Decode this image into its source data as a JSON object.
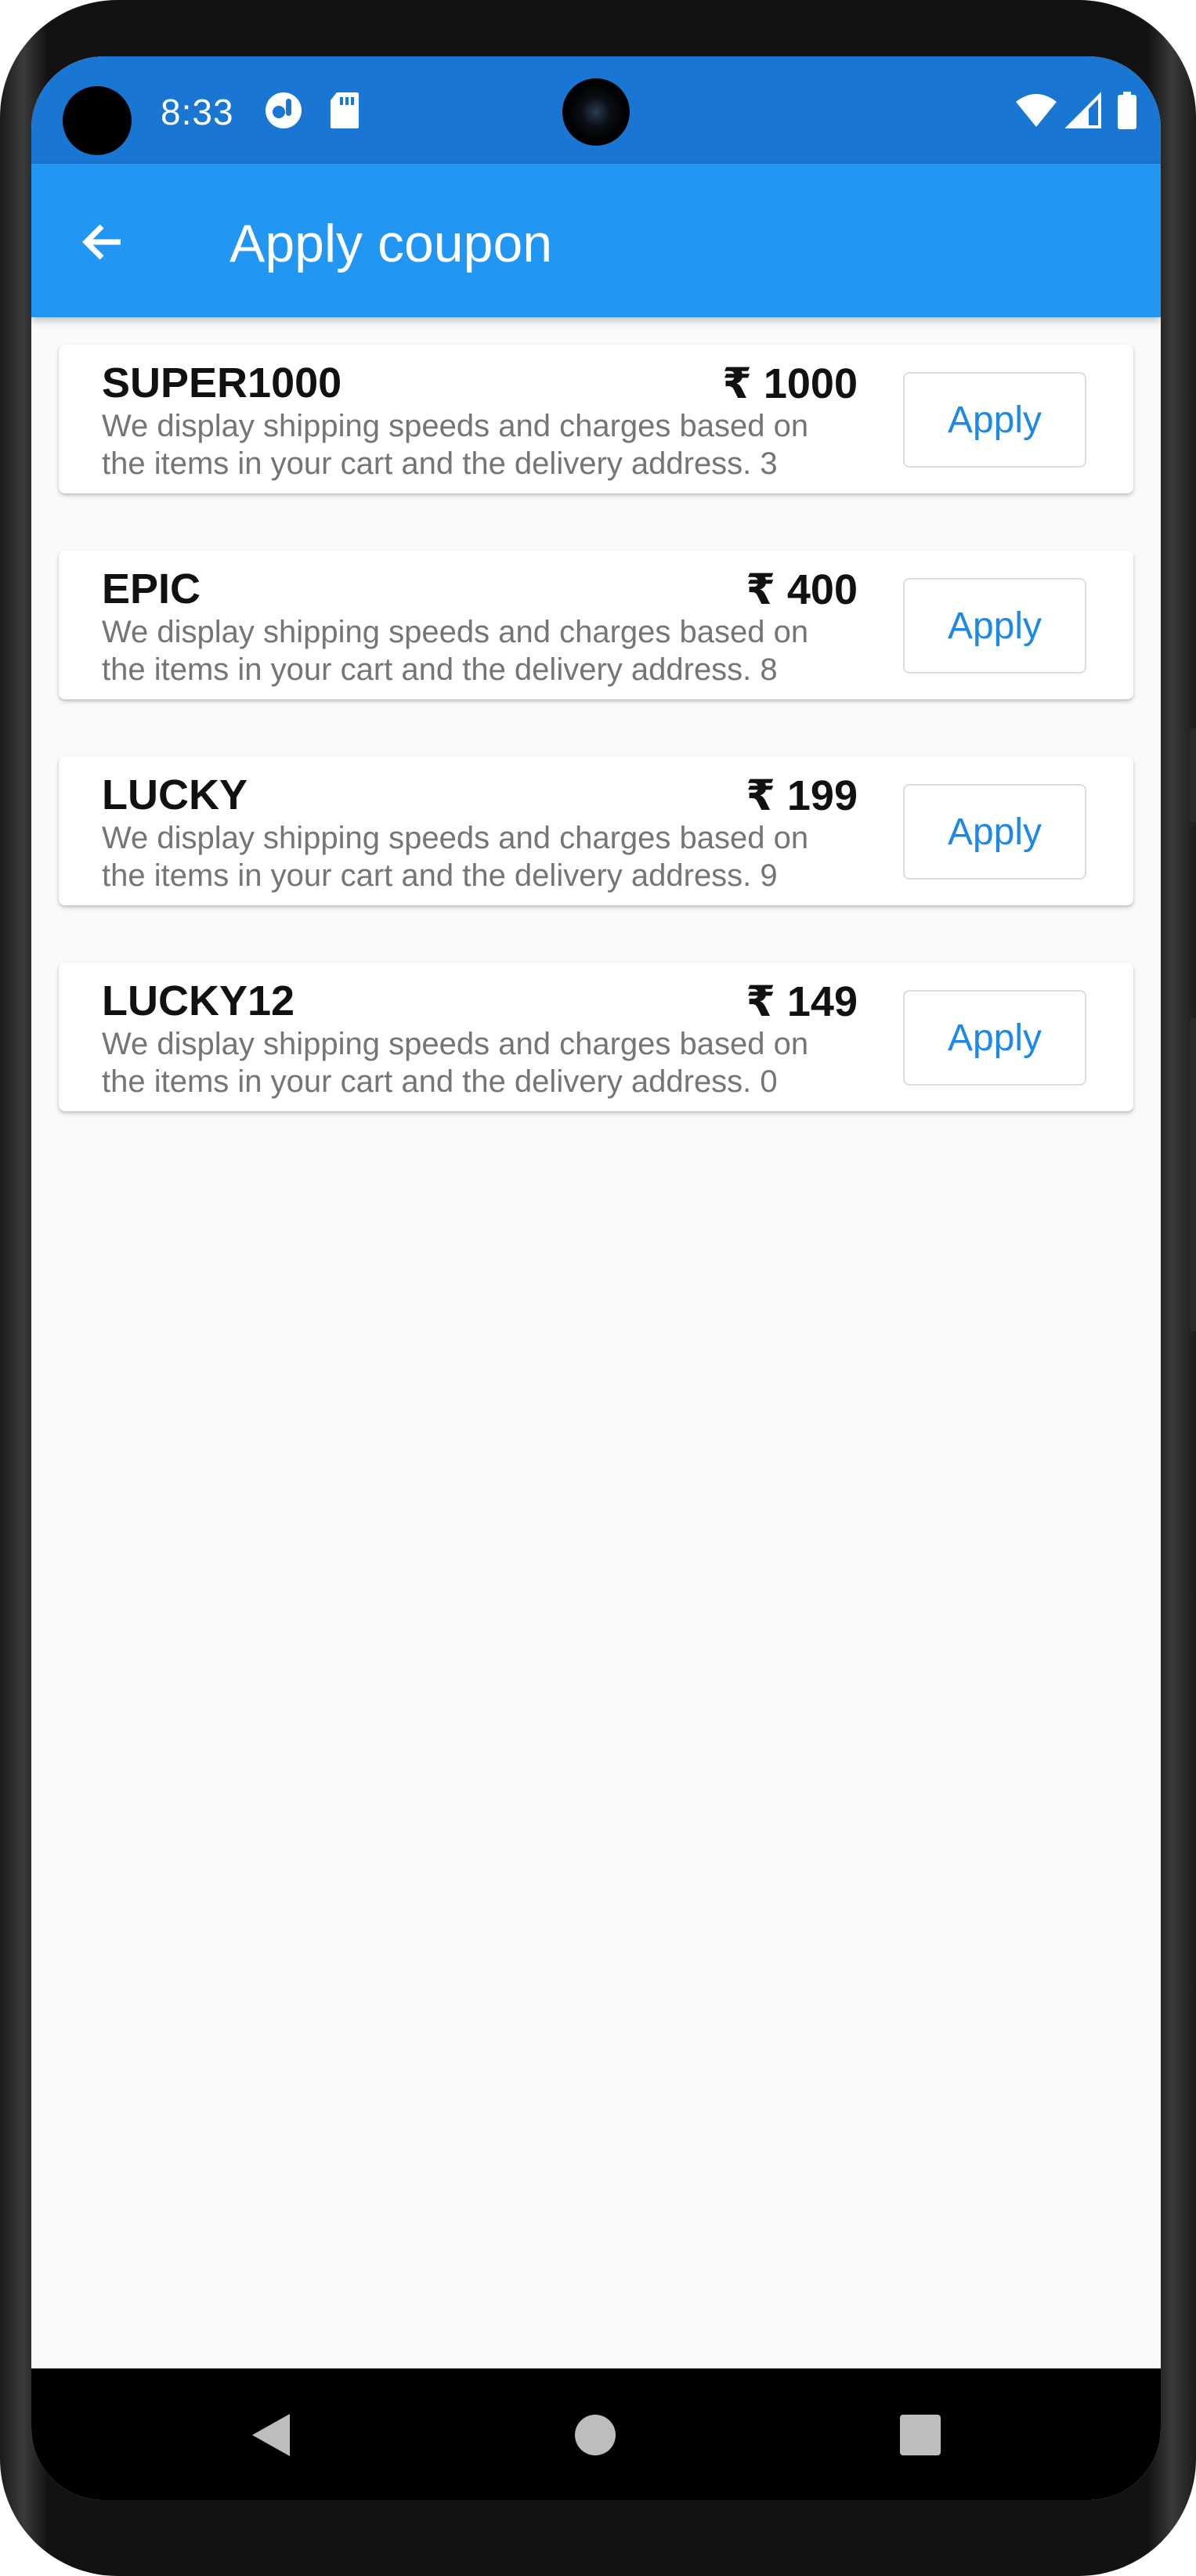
{
  "status_bar": {
    "time": "8:33",
    "icons": [
      "assistant-icon",
      "sd-card-icon",
      "wifi-icon",
      "signal-icon",
      "battery-icon"
    ]
  },
  "app_bar": {
    "title": "Apply coupon",
    "back_icon": "arrow-back-icon"
  },
  "coupons": [
    {
      "code": "SUPER1000",
      "amount": "₹ 1000",
      "description": "We display shipping speeds and charges based on the items in your cart and the delivery address. 3",
      "button_label": "Apply"
    },
    {
      "code": "EPIC",
      "amount": "₹ 400",
      "description": "We display shipping speeds and charges based on the items in your cart and the delivery address. 8",
      "button_label": "Apply"
    },
    {
      "code": "LUCKY",
      "amount": "₹ 199",
      "description": "We display shipping speeds and charges based on the items in your cart and the delivery address. 9",
      "button_label": "Apply"
    },
    {
      "code": "LUCKY12",
      "amount": "₹ 149",
      "description": "We display shipping speeds and charges based on the items in your cart and the delivery address. 0",
      "button_label": "Apply"
    }
  ],
  "nav_bar": {
    "icons": [
      "back-triangle-icon",
      "home-circle-icon",
      "recents-square-icon"
    ]
  },
  "colors": {
    "status_bar": "#1976d2",
    "app_bar": "#2196f3",
    "accent": "#1e88e5",
    "background": "#fafafa"
  }
}
